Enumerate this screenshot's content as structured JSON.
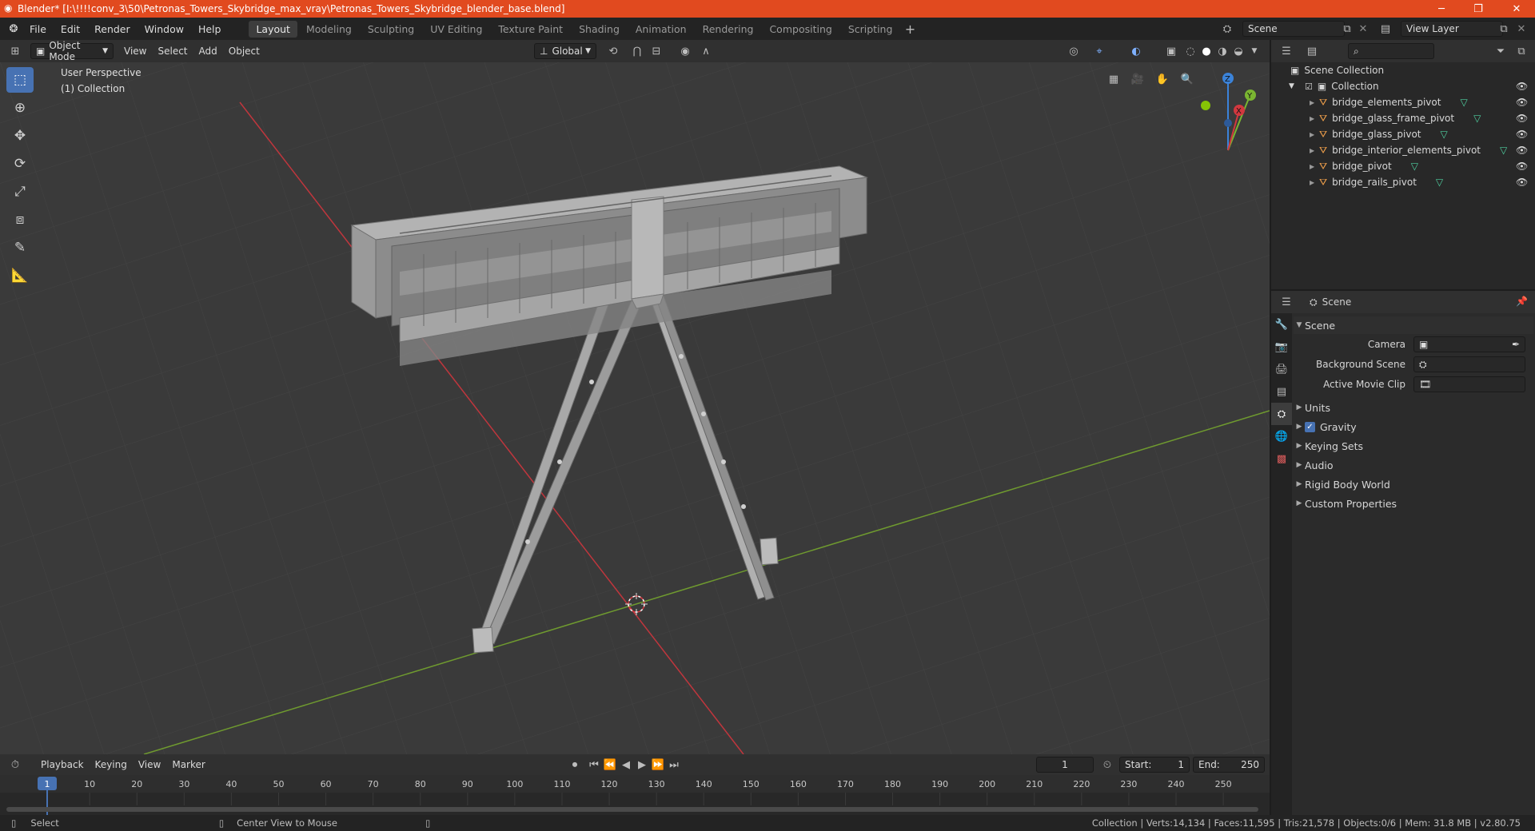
{
  "title": "Blender* [I:\\!!!!conv_3\\50\\Petronas_Towers_Skybridge_max_vray\\Petronas_Towers_Skybridge_blender_base.blend]",
  "menu": [
    "File",
    "Edit",
    "Render",
    "Window",
    "Help"
  ],
  "workspaces": [
    "Layout",
    "Modeling",
    "Sculpting",
    "UV Editing",
    "Texture Paint",
    "Shading",
    "Animation",
    "Rendering",
    "Compositing",
    "Scripting"
  ],
  "scene_name": "Scene",
  "view_layer": "View Layer",
  "viewport_header": {
    "mode": "Object Mode",
    "menus": [
      "View",
      "Select",
      "Add",
      "Object"
    ],
    "transform": "Global"
  },
  "viewport": {
    "perspective": "User Perspective",
    "collection": "(1) Collection",
    "gizmo": {
      "z": "Z",
      "y": "Y",
      "x": "X"
    }
  },
  "outliner": {
    "root": "Scene Collection",
    "collection": "Collection",
    "items": [
      "bridge_elements_pivot",
      "bridge_glass_frame_pivot",
      "bridge_glass_pivot",
      "bridge_interior_elements_pivot",
      "bridge_pivot",
      "bridge_rails_pivot"
    ]
  },
  "properties": {
    "context": "Scene",
    "panel": "Scene",
    "camera_label": "Camera",
    "background_label": "Background Scene",
    "movieclip_label": "Active Movie Clip",
    "sections": [
      "Units",
      "Gravity",
      "Keying Sets",
      "Audio",
      "Rigid Body World",
      "Custom Properties"
    ]
  },
  "timeline": {
    "menus": [
      "Playback",
      "Keying",
      "View",
      "Marker"
    ],
    "current_frame": "1",
    "start_label": "Start:",
    "start": "1",
    "end_label": "End:",
    "end": "250",
    "ticks": [
      "1",
      "10",
      "20",
      "30",
      "40",
      "50",
      "60",
      "70",
      "80",
      "90",
      "100",
      "110",
      "120",
      "130",
      "140",
      "150",
      "160",
      "170",
      "180",
      "190",
      "200",
      "210",
      "220",
      "230",
      "240",
      "250"
    ]
  },
  "status": {
    "left1": "Select",
    "left2": "Center View to Mouse",
    "right": "Collection | Verts:14,134 | Faces:11,595 | Tris:21,578 | Objects:0/6 | Mem: 31.8 MB | v2.80.75"
  },
  "colors": {
    "title_bar": "#e14a1f",
    "active_tool": "#4772b3",
    "x_axis": "#d2383f",
    "y_axis": "#7ab531",
    "z_axis": "#3b83d9"
  }
}
